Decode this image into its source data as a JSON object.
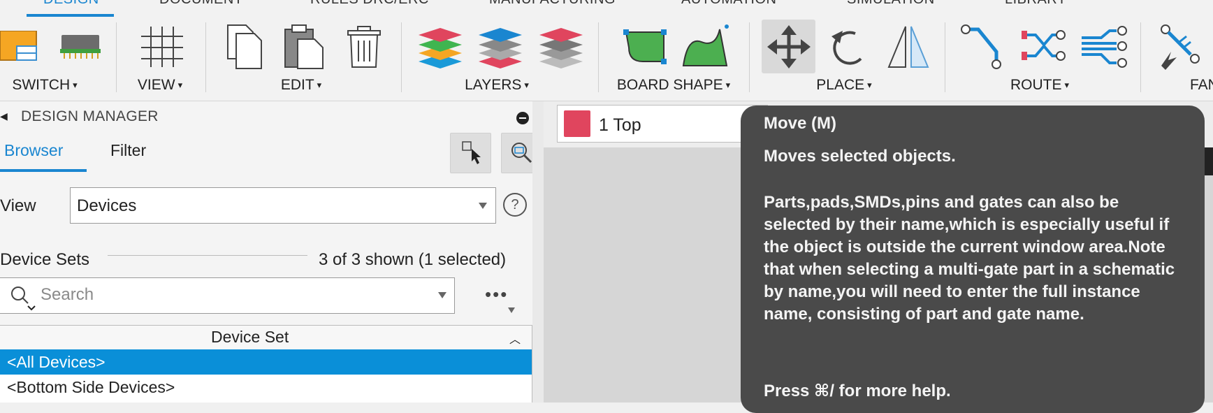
{
  "tabs": [
    {
      "label": "DESIGN",
      "active": true
    },
    {
      "label": "DOCUMENT",
      "active": false
    },
    {
      "label": "RULES DRC/ERC",
      "active": false
    },
    {
      "label": "MANUFACTURING",
      "active": false
    },
    {
      "label": "AUTOMATION",
      "active": false
    },
    {
      "label": "SIMULATION",
      "active": false
    },
    {
      "label": "LIBRARY",
      "active": false
    }
  ],
  "ribbon": {
    "groups": {
      "switch": "SWITCH",
      "view": "VIEW",
      "edit": "EDIT",
      "layers": "LAYERS",
      "board_shape": "BOARD SHAPE",
      "place": "PLACE",
      "route": "ROUTE",
      "fanout": "FANO"
    },
    "caret": "▾"
  },
  "panel": {
    "title": "DESIGN MANAGER",
    "subtabs": {
      "browser": "Browser",
      "filter": "Filter"
    },
    "view_label": "View",
    "view_value": "Devices",
    "help": "?",
    "device_sets_label": "Device Sets",
    "device_sets_count": "3 of 3 shown (1 selected)",
    "search_placeholder": "Search",
    "more": "•••",
    "table_header": "Device Set",
    "rows": [
      "<All Devices>",
      "<Bottom Side Devices>"
    ]
  },
  "canvas": {
    "layer_name": "1 Top",
    "layer_color": "#e0455e"
  },
  "tooltip": {
    "title": "Move (M)",
    "subtitle": "Moves selected objects.",
    "body": "Parts,pads,SMDs,pins and gates can also be selected by their name,which is especially useful if the object is outside the current window area.Note that when selecting a multi-gate part in a schematic by name,you will need to enter the full instance name, consisting of part and gate name.",
    "footer": "Press ⌘/ for more help."
  },
  "colors": {
    "accent": "#1a86d0",
    "selection": "#0a8fd8",
    "tooltip_bg": "#4a4a4a"
  }
}
